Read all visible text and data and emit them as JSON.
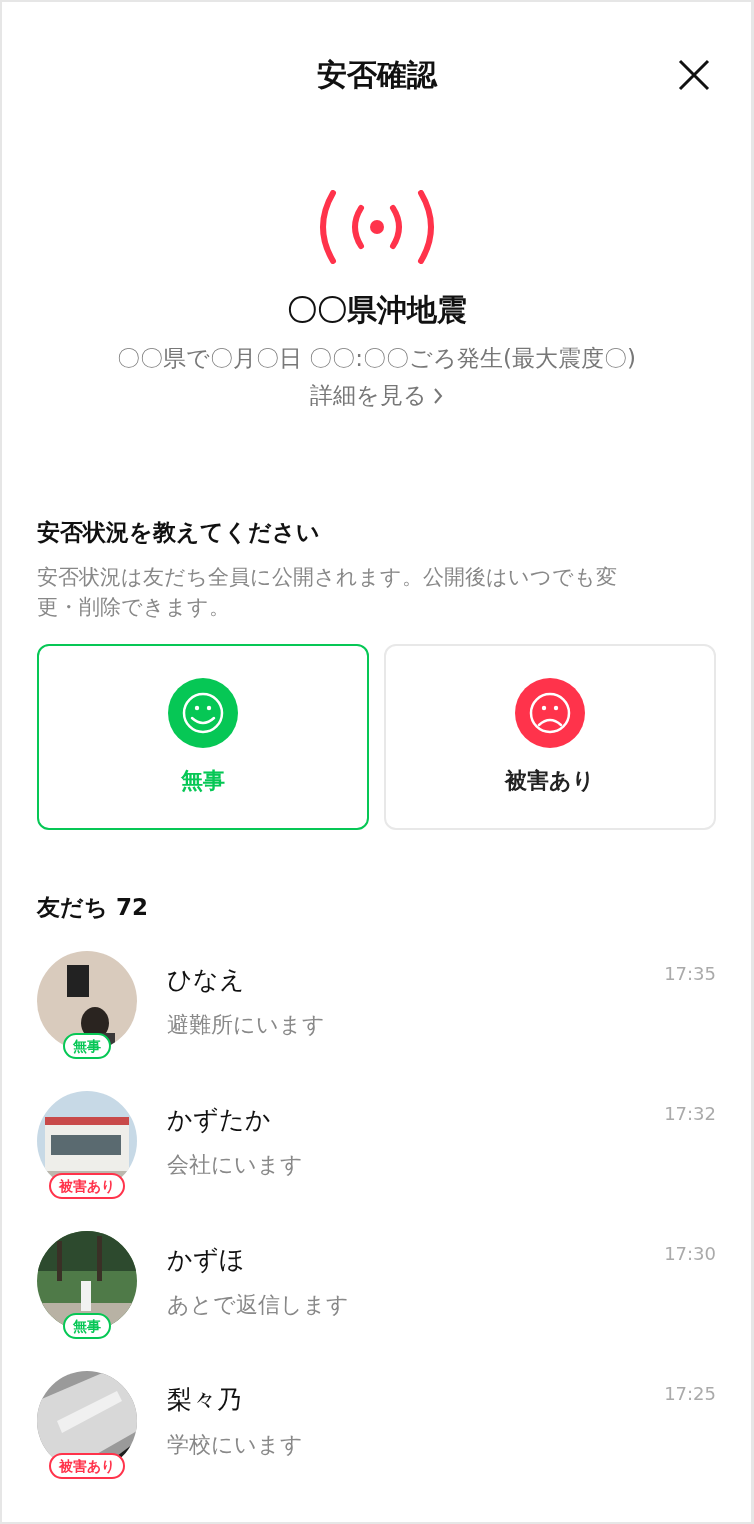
{
  "header": {
    "title": "安否確認"
  },
  "event": {
    "title": "〇〇県沖地震",
    "detail": "〇〇県で〇月〇日 〇〇:〇〇ごろ発生(最大震度〇)",
    "link": "詳細を見る"
  },
  "prompt": {
    "title": "安否状況を教えてください",
    "description": "安否状況は友だち全員に公開されます。公開後はいつでも変更・削除できます。"
  },
  "options": [
    {
      "kind": "safe",
      "label": "無事",
      "selected": true
    },
    {
      "kind": "damaged",
      "label": "被害あり",
      "selected": false
    }
  ],
  "friends": {
    "heading": "友だち 72",
    "items": [
      {
        "name": "ひなえ",
        "message": "避難所にいます",
        "time": "17:35",
        "kind": "safe",
        "badge": "無事"
      },
      {
        "name": "かずたか",
        "message": "会社にいます",
        "time": "17:32",
        "kind": "damaged",
        "badge": "被害あり"
      },
      {
        "name": "かずほ",
        "message": "あとで返信します",
        "time": "17:30",
        "kind": "safe",
        "badge": "無事"
      },
      {
        "name": "梨々乃",
        "message": "学校にいます",
        "time": "17:25",
        "kind": "damaged",
        "badge": "被害あり"
      }
    ]
  }
}
